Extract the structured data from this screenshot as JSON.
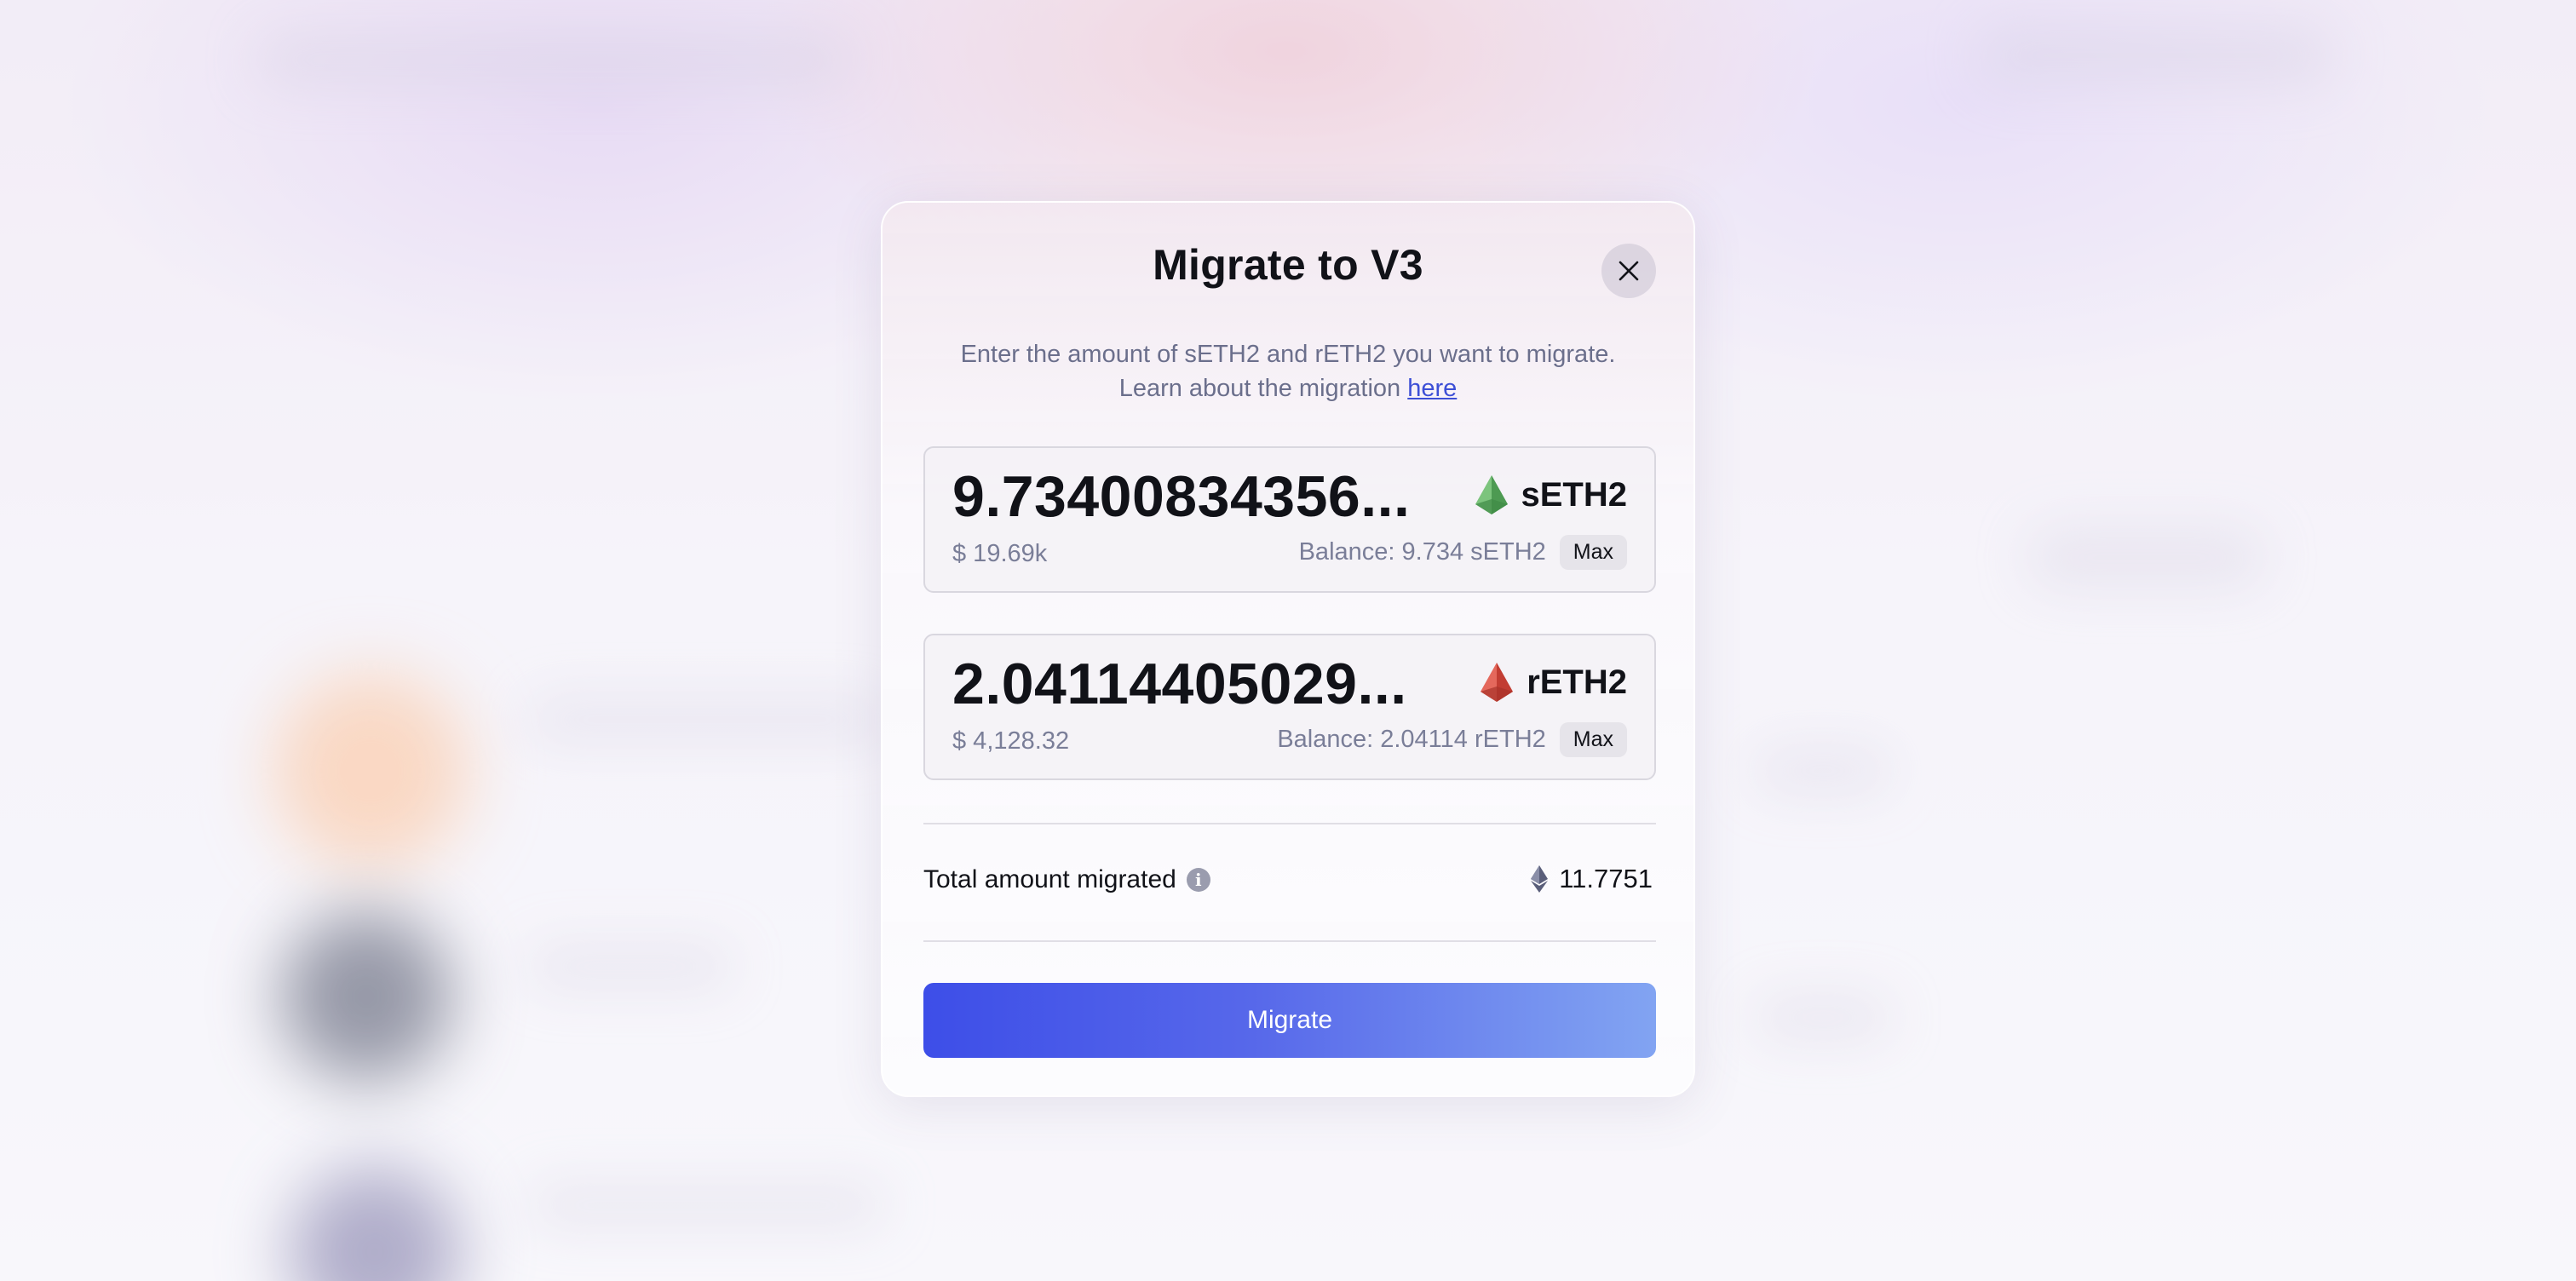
{
  "modal": {
    "title": "Migrate to V3",
    "description_line1": "Enter the amount of sETH2 and rETH2 you want to migrate.",
    "description_prefix": "Learn about the migration ",
    "description_link": "here",
    "close_icon": "close-icon"
  },
  "inputs": [
    {
      "amount": "9.73400834356...",
      "token": "sETH2",
      "token_color": "#5aa75c",
      "usd_value": "$ 19.69k",
      "balance": "Balance: 9.734 sETH2",
      "max_label": "Max"
    },
    {
      "amount": "2.04114405029...",
      "token": "rETH2",
      "token_color": "#d65447",
      "usd_value": "$ 4,128.32",
      "balance": "Balance: 2.04114 rETH2",
      "max_label": "Max"
    }
  ],
  "summary": {
    "total_label": "Total amount migrated",
    "info_icon": "info-icon",
    "eth_icon": "eth-icon",
    "total_value": "11.7751"
  },
  "actions": {
    "migrate_label": "Migrate",
    "accent_start": "#3d4ee8",
    "accent_end": "#82a4f2"
  }
}
